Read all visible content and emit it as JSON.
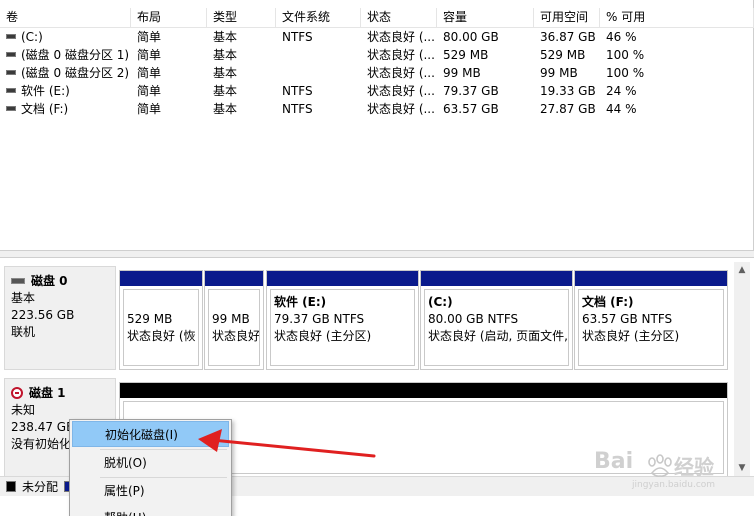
{
  "columns": {
    "volume": "卷",
    "layout": "布局",
    "type": "类型",
    "filesystem": "文件系统",
    "status": "状态",
    "capacity": "容量",
    "free": "可用空间",
    "pct_free": "% 可用"
  },
  "volumes": [
    {
      "name": "(C:)",
      "layout": "简单",
      "type": "基本",
      "fs": "NTFS",
      "status": "状态良好 (...",
      "capacity": "80.00 GB",
      "free": "36.87 GB",
      "pct": "46 %"
    },
    {
      "name": "(磁盘 0 磁盘分区 1)",
      "layout": "简单",
      "type": "基本",
      "fs": "",
      "status": "状态良好 (...",
      "capacity": "529 MB",
      "free": "529 MB",
      "pct": "100 %"
    },
    {
      "name": "(磁盘 0 磁盘分区 2)",
      "layout": "简单",
      "type": "基本",
      "fs": "",
      "status": "状态良好 (...",
      "capacity": "99 MB",
      "free": "99 MB",
      "pct": "100 %"
    },
    {
      "name": "软件 (E:)",
      "layout": "简单",
      "type": "基本",
      "fs": "NTFS",
      "status": "状态良好 (...",
      "capacity": "79.37 GB",
      "free": "19.33 GB",
      "pct": "24 %"
    },
    {
      "name": "文档 (F:)",
      "layout": "简单",
      "type": "基本",
      "fs": "NTFS",
      "status": "状态良好 (...",
      "capacity": "63.57 GB",
      "free": "27.87 GB",
      "pct": "44 %"
    }
  ],
  "disk0": {
    "title": "磁盘 0",
    "kind": "基本",
    "size": "223.56 GB",
    "state": "联机",
    "partitions": [
      {
        "name": "",
        "size": "529 MB",
        "status": "状态良好 (恢"
      },
      {
        "name": "",
        "size": "99 MB",
        "status": "状态良好"
      },
      {
        "name": "软件  (E:)",
        "size": "79.37 GB NTFS",
        "status": "状态良好 (主分区)"
      },
      {
        "name": "(C:)",
        "size": "80.00 GB NTFS",
        "status": "状态良好 (启动, 页面文件,"
      },
      {
        "name": "文档  (F:)",
        "size": "63.57 GB NTFS",
        "status": "状态良好 (主分区)"
      }
    ]
  },
  "disk1": {
    "title": "磁盘 1",
    "kind": "未知",
    "size": "238.47 GB",
    "state": "没有初始化"
  },
  "legend": {
    "unallocated": "未分配"
  },
  "context_menu": {
    "items": [
      "初始化磁盘(I)",
      "脱机(O)",
      "属性(P)",
      "帮助(H)"
    ]
  },
  "watermark": {
    "brand": "Bai",
    "brand2": "经验",
    "url": "jingyan.baidu.com"
  },
  "colors": {
    "partition_bar": "#0a1a8c",
    "unallocated_bar": "#000000",
    "menu_highlight": "#91c9f7",
    "arrow": "#e02020"
  }
}
